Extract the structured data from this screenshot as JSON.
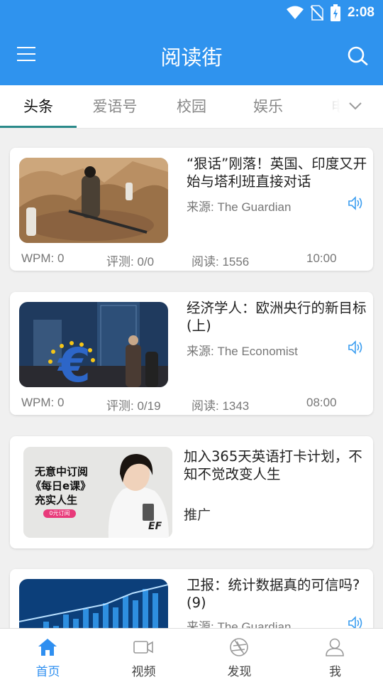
{
  "status_bar": {
    "time": "2:08"
  },
  "app_bar": {
    "title": "阅读街"
  },
  "tabs": [
    {
      "label": "头条",
      "active": true
    },
    {
      "label": "爱语号"
    },
    {
      "label": "校园"
    },
    {
      "label": "娱乐"
    },
    {
      "label": "电"
    }
  ],
  "articles": [
    {
      "title": "“狠话”刚落！英国、印度又开始与塔利班直接对话",
      "source": "来源: The Guardian",
      "wpm": "WPM: 0",
      "eval": "评测: 0/0",
      "reads": "阅读: 1556",
      "time": "10:00"
    },
    {
      "title": "经济学人：欧洲央行的新目标 (上)",
      "source": "来源: The Economist",
      "wpm": "WPM: 0",
      "eval": "评测: 0/19",
      "reads": "阅读: 1343",
      "time": "08:00"
    },
    {
      "title": "卫报：统计数据真的可信吗? (9)",
      "source": "来源: The Guardian"
    }
  ],
  "promo": {
    "title": "加入365天英语打卡计划，不知不觉改变人生",
    "tag": "推广",
    "banner_lines": [
      "无意中订阅",
      "《每日e课》",
      "充实人生"
    ],
    "banner_badge": "0元订阅",
    "banner_logo": "EF"
  },
  "bottom_nav": [
    {
      "label": "首页",
      "active": true
    },
    {
      "label": "视频"
    },
    {
      "label": "发现"
    },
    {
      "label": "我"
    }
  ],
  "colors": {
    "primary": "#2f93ee",
    "tab_underline": "#2a8a8a",
    "nav_active": "#2f8ff0"
  }
}
